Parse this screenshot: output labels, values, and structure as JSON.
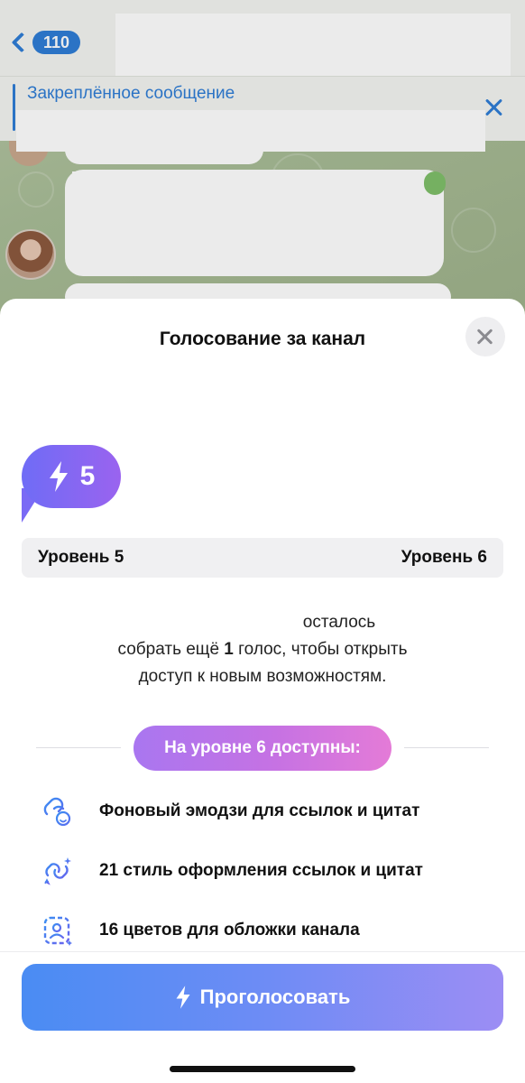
{
  "chat": {
    "back_count": "110",
    "pinned_label": "Закреплённое сообщение"
  },
  "sheet": {
    "title": "Голосование за канал",
    "current_level": "5",
    "level_left": "Уровень 5",
    "level_right": "Уровень 6",
    "desc_line1": "осталось",
    "desc_line2_pre": "собрать ещё ",
    "desc_line2_bold": "1",
    "desc_line2_post": " голос, чтобы открыть",
    "desc_line3": "доступ к новым возможностям.",
    "section_label": "На уровне 6 доступны:",
    "features": [
      {
        "icon": "link-emoji-icon",
        "label": "Фоновый эмодзи для ссылок и цитат"
      },
      {
        "icon": "link-style-icon",
        "label": "21 стиль оформления ссылок и цитат"
      },
      {
        "icon": "cover-color-icon",
        "label": "16 цветов для обложки канала"
      }
    ],
    "vote_button": "Проголосовать"
  },
  "colors": {
    "accent": "#2f7dd6",
    "badge": "#7a6af5",
    "pill": "#c672e3",
    "button": "#6d8cf5"
  }
}
